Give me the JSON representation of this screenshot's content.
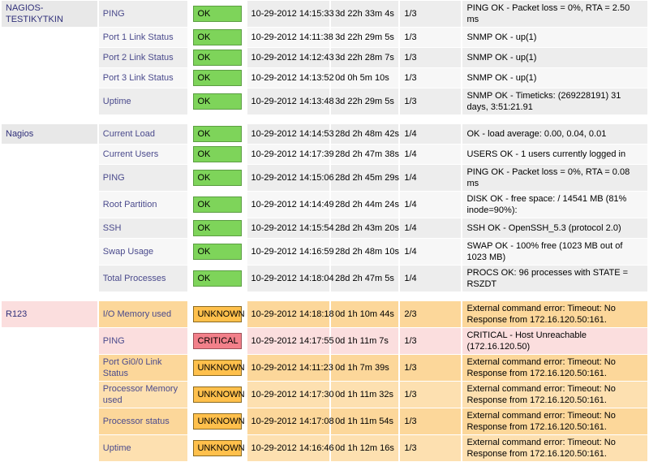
{
  "table": {
    "hosts": [
      {
        "name": "NAGIOS-TESTIKYTKIN",
        "host_state": "ok",
        "services": [
          {
            "service": "PING",
            "status": "OK",
            "state": "ok",
            "last_check": "10-29-2012 14:15:33",
            "duration": "3d 22h 33m 4s",
            "attempt": "1/3",
            "info": "PING OK - Packet loss = 0%, RTA = 2.50 ms",
            "tall": true
          },
          {
            "service": "Port 1 Link Status",
            "status": "OK",
            "state": "ok",
            "last_check": "10-29-2012 14:11:38",
            "duration": "3d 22h 29m 5s",
            "attempt": "1/3",
            "info": "SNMP OK - up(1)",
            "tall": true
          },
          {
            "service": "Port 2 Link Status",
            "status": "OK",
            "state": "ok",
            "last_check": "10-29-2012 14:12:43",
            "duration": "3d 22h 28m 7s",
            "attempt": "1/3",
            "info": "SNMP OK - up(1)",
            "tall": true
          },
          {
            "service": "Port 3 Link Status",
            "status": "OK",
            "state": "ok",
            "last_check": "10-29-2012 14:13:52",
            "duration": "0d 0h 5m 10s",
            "attempt": "1/3",
            "info": "SNMP OK - up(1)",
            "tall": true
          },
          {
            "service": "Uptime",
            "status": "OK",
            "state": "ok",
            "last_check": "10-29-2012 14:13:48",
            "duration": "3d 22h 29m 5s",
            "attempt": "1/3",
            "info": "SNMP OK - Timeticks: (269228191) 31 days, 3:51:21.91",
            "tall": true
          }
        ]
      },
      {
        "name": "Nagios",
        "host_state": "ok",
        "services": [
          {
            "service": "Current Load",
            "status": "OK",
            "state": "ok",
            "last_check": "10-29-2012 14:14:53",
            "duration": "28d 2h 48m 42s",
            "attempt": "1/4",
            "info": "OK - load average: 0.00, 0.04, 0.01",
            "tall": false
          },
          {
            "service": "Current Users",
            "status": "OK",
            "state": "ok",
            "last_check": "10-29-2012 14:17:39",
            "duration": "28d 2h 47m 38s",
            "attempt": "1/4",
            "info": "USERS OK - 1 users currently logged in",
            "tall": false
          },
          {
            "service": "PING",
            "status": "OK",
            "state": "ok",
            "last_check": "10-29-2012 14:15:06",
            "duration": "28d 2h 45m 29s",
            "attempt": "1/4",
            "info": "PING OK - Packet loss = 0%, RTA = 0.08 ms",
            "tall": false
          },
          {
            "service": "Root Partition",
            "status": "OK",
            "state": "ok",
            "last_check": "10-29-2012 14:14:49",
            "duration": "28d 2h 44m 24s",
            "attempt": "1/4",
            "info": "DISK OK - free space: / 14541 MB (81% inode=90%):",
            "tall": true
          },
          {
            "service": "SSH",
            "status": "OK",
            "state": "ok",
            "last_check": "10-29-2012 14:15:54",
            "duration": "28d 2h 43m 20s",
            "attempt": "1/4",
            "info": "SSH OK - OpenSSH_5.3 (protocol 2.0)",
            "tall": false
          },
          {
            "service": "Swap Usage",
            "status": "OK",
            "state": "ok",
            "last_check": "10-29-2012 14:16:59",
            "duration": "28d 2h 48m 10s",
            "attempt": "1/4",
            "info": "SWAP OK - 100% free (1023 MB out of 1023 MB)",
            "tall": true
          },
          {
            "service": "Total Processes",
            "status": "OK",
            "state": "ok",
            "last_check": "10-29-2012 14:18:04",
            "duration": "28d 2h 47m 5s",
            "attempt": "1/4",
            "info": "PROCS OK: 96 processes with STATE = RSZDT",
            "tall": true
          }
        ]
      },
      {
        "name": "R123",
        "host_state": "critical",
        "services": [
          {
            "service": "I/O Memory used",
            "status": "UNKNOWN",
            "state": "unknown",
            "last_check": "10-29-2012 14:18:18",
            "duration": "0d 1h 10m 44s",
            "attempt": "2/3",
            "info": "External command error: Timeout: No Response from 172.16.120.50:161.",
            "tall": true
          },
          {
            "service": "PING",
            "status": "CRITICAL",
            "state": "critical",
            "last_check": "10-29-2012 14:17:55",
            "duration": "0d 1h 11m 7s",
            "attempt": "1/3",
            "info": "CRITICAL - Host Unreachable (172.16.120.50)",
            "tall": true
          },
          {
            "service": "Port Gi0/0 Link Status",
            "status": "UNKNOWN",
            "state": "unknown",
            "last_check": "10-29-2012 14:11:23",
            "duration": "0d 1h 7m 39s",
            "attempt": "1/3",
            "info": "External command error: Timeout: No Response from 172.16.120.50:161.",
            "tall": true
          },
          {
            "service": "Processor Memory used",
            "status": "UNKNOWN",
            "state": "unknown",
            "last_check": "10-29-2012 14:17:30",
            "duration": "0d 1h 11m 32s",
            "attempt": "1/3",
            "info": "External command error: Timeout: No Response from 172.16.120.50:161.",
            "tall": true
          },
          {
            "service": "Processor status",
            "status": "UNKNOWN",
            "state": "unknown",
            "last_check": "10-29-2012 14:17:08",
            "duration": "0d 1h 11m 54s",
            "attempt": "1/3",
            "info": "External command error: Timeout: No Response from 172.16.120.50:161.",
            "tall": true
          },
          {
            "service": "Uptime",
            "status": "UNKNOWN",
            "state": "unknown",
            "last_check": "10-29-2012 14:16:46",
            "duration": "0d 1h 12m 16s",
            "attempt": "1/3",
            "info": "External command error: Timeout: No Response from 172.16.120.50:161.",
            "tall": true
          }
        ]
      }
    ]
  },
  "colors": {
    "ok_badge": "#7ed45a",
    "unknown_badge": "#ffc04c",
    "critical_badge": "#f2808a",
    "ok_row": "#ededed",
    "unknown_row": "#fcd79a",
    "critical_row": "#fbdede",
    "link": "#4a4a8c"
  }
}
